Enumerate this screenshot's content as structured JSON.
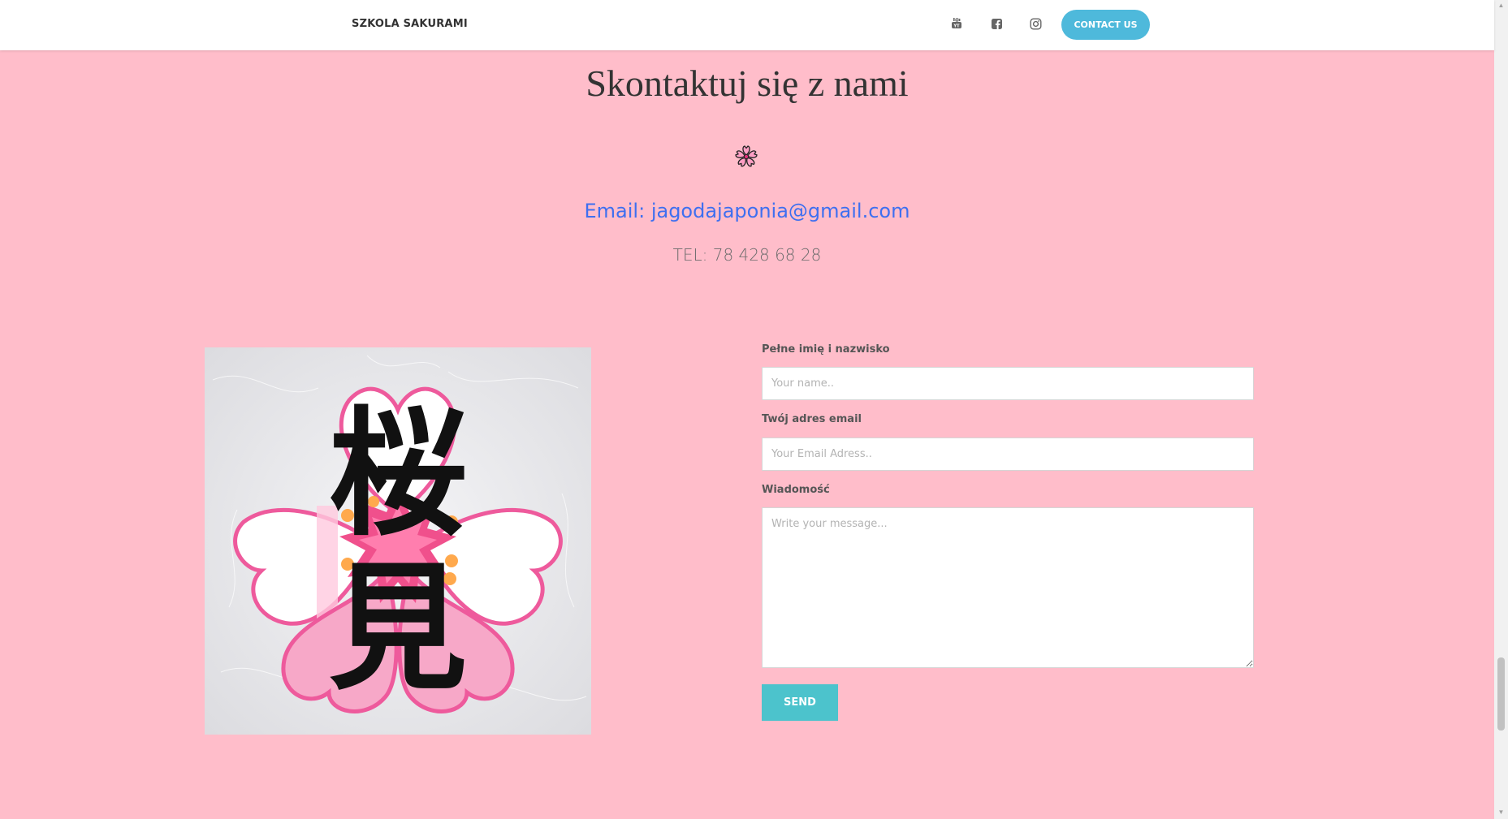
{
  "header": {
    "brand": "SZKOLA SAKURAMI",
    "social_icons": [
      "youtube-icon",
      "facebook-icon",
      "instagram-icon"
    ],
    "contact_button": "CONTACT US"
  },
  "contact": {
    "title": "Skontaktuj się z nami",
    "email": "Email: jagodajaponia@gmail.com",
    "tel": "TEL: 78 428 68 28"
  },
  "image": {
    "kanji_top": "桜",
    "kanji_bottom": "見"
  },
  "form": {
    "name_label": "Pełne imię i nazwisko",
    "name_placeholder": "Your name..",
    "email_label": "Twój adres email",
    "email_placeholder": "Your Email Adress..",
    "message_label": "Wiadomość",
    "message_placeholder": "Write your message...",
    "send_label": "SEND"
  },
  "colors": {
    "background": "#ffbdca",
    "accent_button": "#4eb9db",
    "send_button": "#4cc3cc",
    "email_link": "#3e6ff0"
  }
}
